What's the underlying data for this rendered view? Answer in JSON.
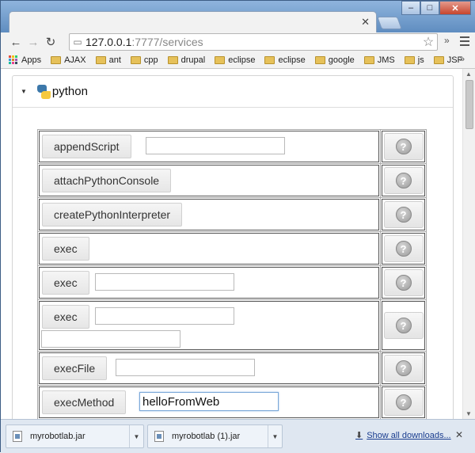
{
  "window": {
    "minimize": "–",
    "maximize": "□",
    "close": "✕"
  },
  "tab": {
    "close": "✕"
  },
  "nav": {
    "back": "←",
    "forward": "→",
    "reload": "↻"
  },
  "address": {
    "host": "127.0.0.1",
    "rest": ":7777/services"
  },
  "toolbar": {
    "overflow": "»"
  },
  "bookmarks": {
    "items": [
      "Apps",
      "AJAX",
      "ant",
      "cpp",
      "drupal",
      "eclipse",
      "eclipse",
      "google",
      "JMS",
      "js",
      "JSF"
    ],
    "overflow": "»"
  },
  "panel": {
    "title": "python"
  },
  "methods": [
    {
      "label": "appendScript",
      "fields": [
        ""
      ]
    },
    {
      "label": "attachPythonConsole",
      "fields": []
    },
    {
      "label": "createPythonInterpreter",
      "fields": []
    },
    {
      "label": "exec",
      "fields": []
    },
    {
      "label": "exec",
      "fields": [
        ""
      ]
    },
    {
      "label": "exec",
      "fields": [
        "",
        ""
      ]
    },
    {
      "label": "execFile",
      "fields": [
        ""
      ]
    },
    {
      "label": "execMethod",
      "fields": [
        "helloFromWeb"
      ]
    }
  ],
  "help": {
    "glyph": "?"
  },
  "downloads": {
    "files": [
      "myrobotlab.jar",
      "myrobotlab (1).jar"
    ],
    "show_all": "Show all downloads...",
    "close": "✕"
  }
}
